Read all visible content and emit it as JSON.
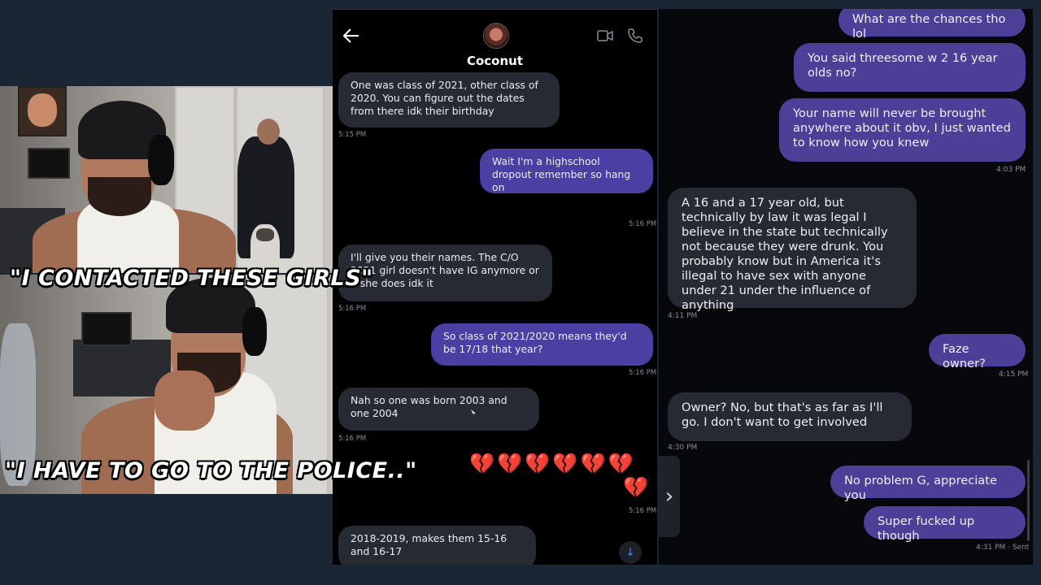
{
  "captions": {
    "top": "\"I CONTACTED THESE GIRLS\"",
    "bottom": "\"I HAVE TO GO TO THE POLICE..\""
  },
  "left_chat": {
    "contact_name": "Coconut",
    "messages": [
      {
        "dir": "in",
        "text": "One was class of 2021, other class of 2020. You can figure out the dates from there idk their birthday",
        "time": "5:15 PM"
      },
      {
        "dir": "out",
        "text": "Wait I'm a highschool dropout remember so hang on",
        "time": ""
      },
      {
        "dir": "out",
        "emoji": "😂",
        "time": "5:16 PM"
      },
      {
        "dir": "in",
        "text": "I'll give you their names. The C/O 2021 girl doesn't have IG anymore or if she does idk it",
        "time": "5:16 PM"
      },
      {
        "dir": "out",
        "text": "So class of 2021/2020 means they'd be 17/18 that year?",
        "time": "5:16 PM"
      },
      {
        "dir": "in",
        "text": "Nah so one was born 2003 and one 2004",
        "time": "5:16 PM"
      },
      {
        "dir": "out",
        "emoji_row1": "💔💔💔💔💔💔",
        "emoji_row2": "💔",
        "time": "5:16 PM"
      },
      {
        "dir": "in",
        "text": "2018-2019, makes them 15-16 and 16-17",
        "time": ""
      }
    ]
  },
  "right_chat": {
    "messages": [
      {
        "dir": "out",
        "text": "What are the chances tho lol",
        "time": ""
      },
      {
        "dir": "out",
        "text": "You said threesome w 2 16 year olds no?",
        "time": ""
      },
      {
        "dir": "out",
        "text": "Your name will never be brought anywhere about it obv, I just wanted to know how you knew",
        "time": "4:03 PM"
      },
      {
        "dir": "in",
        "text": "A 16 and a 17 year old, but technically by law it was legal I believe in the state but technically not because they were drunk. You probably know but in America it's illegal to have sex with anyone under 21 under the influence of anything",
        "time": "4:11 PM"
      },
      {
        "dir": "out",
        "text": "Faze owner?",
        "time": "4:15 PM"
      },
      {
        "dir": "in",
        "text": "Owner? No, but that's as far as I'll go. I don't want to get involved",
        "time": "4:30 PM"
      },
      {
        "dir": "out",
        "text": "No problem G, appreciate you",
        "time": ""
      },
      {
        "dir": "out",
        "text": "Super fucked up though",
        "time": "4:31 PM · Sent"
      }
    ]
  },
  "icons": {
    "back": "arrow-left-icon",
    "video": "video-camera-icon",
    "phone": "phone-icon",
    "scroll": "arrow-down-icon",
    "expand": "chevron-right-icon"
  },
  "colors": {
    "background": "#1b2634",
    "incoming_bubble": "#262a33",
    "outgoing_bubble": "#4a3fa2"
  }
}
